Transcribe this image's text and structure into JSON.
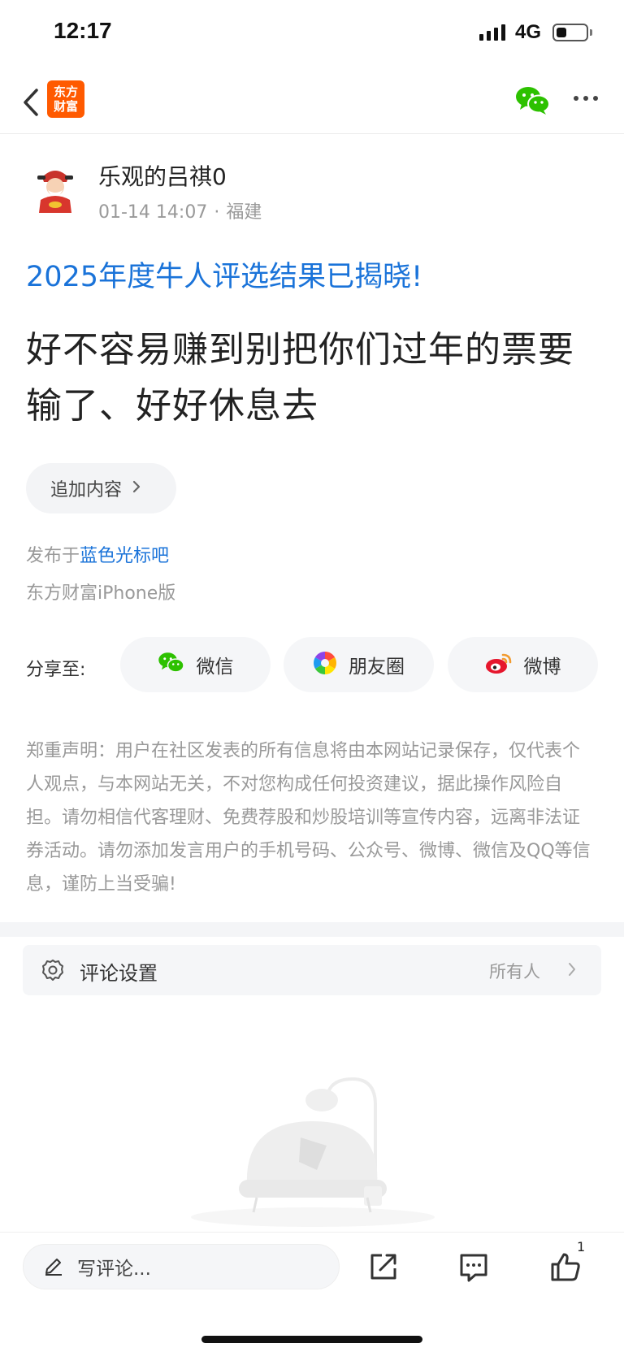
{
  "status_bar": {
    "time": "12:17",
    "network": "4G",
    "battery_level": 0.35
  },
  "nav": {
    "logo_text_line1": "东方",
    "logo_text_line2": "财富",
    "back_icon": "chevron-left-icon",
    "share_icon": "wechat-icon",
    "more_icon": "more-icon"
  },
  "author": {
    "name": "乐观的吕祺0",
    "datetime": "01-14 14:07",
    "location": "福建"
  },
  "post": {
    "banner": "2025年度牛人评选结果已揭晓!",
    "body": "好不容易赚到别把你们过年的票要输了、好好休息去",
    "append_label": "追加内容",
    "posted_in_prefix": "发布于",
    "forum": "蓝色光标吧",
    "client": "东方财富iPhone版"
  },
  "share": {
    "label": "分享至:",
    "targets": [
      {
        "label": "微信",
        "icon": "wechat-icon"
      },
      {
        "label": "朋友圈",
        "icon": "moments-icon"
      },
      {
        "label": "微博",
        "icon": "weibo-icon"
      }
    ]
  },
  "disclaimer": "郑重声明：用户在社区发表的所有信息将由本网站记录保存，仅代表个人观点，与本网站无关，不对您构成任何投资建议，据此操作风险自担。请勿相信代客理财、免费荐股和炒股培训等宣传内容，远离非法证券活动。请勿添加发言用户的手机号码、公众号、微博、微信及QQ等信息，谨防上当受骗!",
  "comment_settings": {
    "label": "评论设置",
    "value": "所有人",
    "icon": "gear-icon"
  },
  "bottom_bar": {
    "comment_placeholder": "写评论...",
    "like_count": "1",
    "icons": [
      "edit-icon",
      "share-out-icon",
      "comment-icon",
      "thumbs-up-icon"
    ]
  },
  "colors": {
    "link": "#1a73d9",
    "brand": "#ff5a00",
    "wechat": "#2dc100",
    "weibo": "#e6162d"
  }
}
